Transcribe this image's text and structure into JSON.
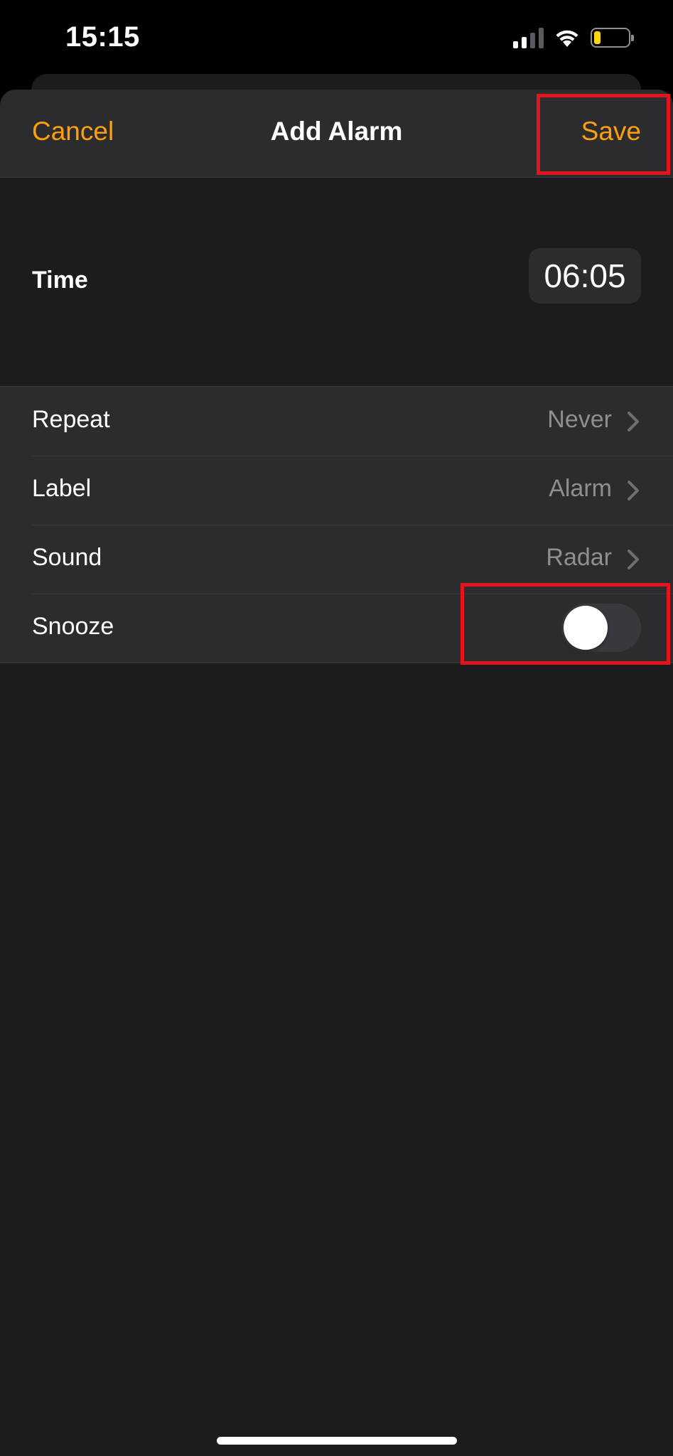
{
  "status_bar": {
    "time": "15:15",
    "icons": [
      "cellular-signal-icon",
      "wifi-icon",
      "battery-icon"
    ],
    "battery_level": 0.2
  },
  "nav": {
    "cancel_label": "Cancel",
    "title": "Add Alarm",
    "save_label": "Save"
  },
  "time_section": {
    "label": "Time",
    "value": "06:05"
  },
  "settings": {
    "repeat": {
      "label": "Repeat",
      "value": "Never"
    },
    "label": {
      "label": "Label",
      "value": "Alarm"
    },
    "sound": {
      "label": "Sound",
      "value": "Radar"
    },
    "snooze": {
      "label": "Snooze",
      "enabled": false
    }
  },
  "colors": {
    "accent": "#ff9f0a",
    "highlight": "#e2141c",
    "sheet_bg": "#1c1c1e",
    "group_bg": "#2c2c2e",
    "secondary_text": "#8e8e93"
  }
}
